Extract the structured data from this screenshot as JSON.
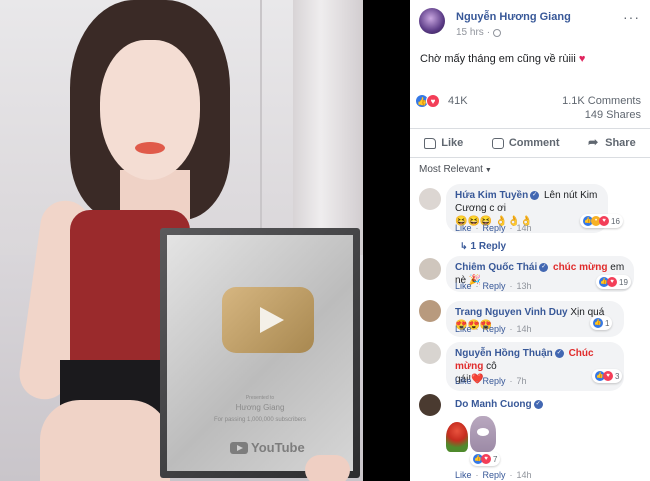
{
  "post": {
    "author": "Nguyễn Hương Giang",
    "time": "15 hrs",
    "caption": "Chờ mấy tháng em cũng về rùiii",
    "caption_emoji": "♥",
    "more": "···"
  },
  "photo": {
    "plaque_subtitle": "Presented to",
    "plaque_name": "Hương Giang",
    "plaque_passing": "For passing 1,000,000 subscribers",
    "logo": "YouTube"
  },
  "stats": {
    "reactions": "41K",
    "comments": "1.1K Comments",
    "shares": "149 Shares"
  },
  "actions": {
    "like": "Like",
    "comment": "Comment",
    "share": "Share"
  },
  "sort": {
    "label": "Most Relevant"
  },
  "comments": [
    {
      "name": "Hứa Kim Tuyền",
      "text_before": " Lên nút Kim Cương c ơi",
      "highlight": "",
      "text_after": "",
      "line2": "😆😆😆 👌👌👌",
      "like": "Like",
      "reply": "Reply",
      "time": "14h",
      "react_count": "16",
      "replies": "1 Reply"
    },
    {
      "name": "Chiêm Quốc Thái",
      "text_before": " ",
      "highlight": "chúc mừng",
      "text_after": " em nè 🎉",
      "line2": "",
      "like": "Like",
      "reply": "Reply",
      "time": "13h",
      "react_count": "19"
    },
    {
      "name": "Trang Nguyen Vinh Duy",
      "text_before": " Xịn quá 😍😍😍",
      "highlight": "",
      "text_after": "",
      "line2": "",
      "like": "Like",
      "reply": "Reply",
      "time": "14h",
      "react_count": "1"
    },
    {
      "name": "Nguyễn Hồng Thuận",
      "text_before": " ",
      "highlight": "Chúc mừng",
      "text_after": " cô",
      "line2": "gái!❤️",
      "like": "Like",
      "reply": "Reply",
      "time": "7h",
      "react_count": "3"
    },
    {
      "name": "Do Manh Cuong",
      "text_before": "",
      "highlight": "",
      "text_after": "",
      "line2": "",
      "like": "Like",
      "reply": "Reply",
      "time": "14h",
      "react_count": "7"
    }
  ],
  "icons": {
    "like": "like-icon",
    "comment": "comment-icon",
    "share": "share-icon",
    "globe": "globe-icon",
    "verified": "verified-icon"
  },
  "colors": {
    "link": "#385898",
    "like_blue": "#3578e5",
    "love_red": "#f33e58",
    "highlight_red": "#e02b2b"
  }
}
